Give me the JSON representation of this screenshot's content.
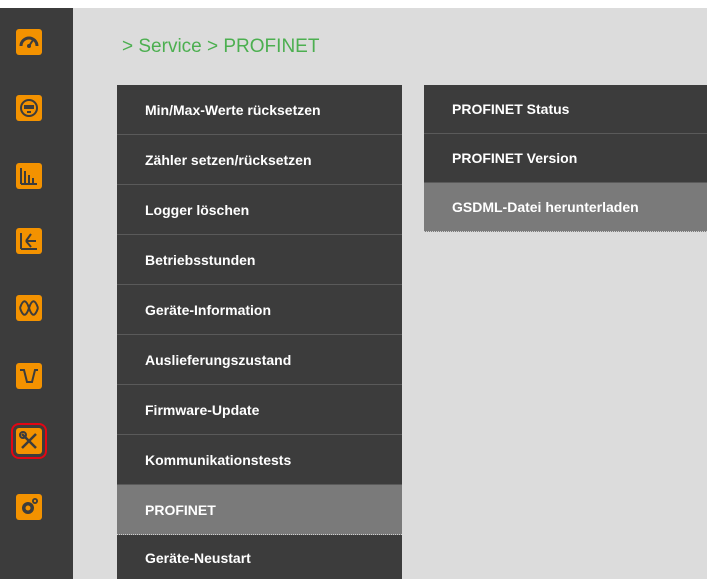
{
  "sidebar": {
    "accent_color": "#f39200",
    "active_outline_color": "#e30613",
    "items": [
      {
        "icon": "gauge-icon",
        "active": false
      },
      {
        "icon": "meter-display-icon",
        "active": false
      },
      {
        "icon": "bar-chart-icon",
        "active": false
      },
      {
        "icon": "phasor-diagram-icon",
        "active": false
      },
      {
        "icon": "harmonics-wave-icon",
        "active": false
      },
      {
        "icon": "dip-waveform-icon",
        "active": false
      },
      {
        "icon": "service-tools-icon",
        "active": true
      },
      {
        "icon": "settings-gears-icon",
        "active": false
      }
    ]
  },
  "breadcrumb": "> Service > PROFINET",
  "left_menu": [
    {
      "label": "Min/Max-Werte rücksetzen",
      "selected": false
    },
    {
      "label": "Zähler setzen/rücksetzen",
      "selected": false
    },
    {
      "label": "Logger löschen",
      "selected": false
    },
    {
      "label": "Betriebsstunden",
      "selected": false
    },
    {
      "label": "Geräte-Information",
      "selected": false
    },
    {
      "label": "Auslieferungszustand",
      "selected": false
    },
    {
      "label": "Firmware-Update",
      "selected": false
    },
    {
      "label": "Kommunikationstests",
      "selected": false
    },
    {
      "label": "PROFINET",
      "selected": true
    },
    {
      "label": "Geräte-Neustart",
      "selected": false
    }
  ],
  "right_menu": [
    {
      "label": "PROFINET Status",
      "selected": false
    },
    {
      "label": "PROFINET Version",
      "selected": false
    },
    {
      "label": "GSDML-Datei herunterladen",
      "selected": true
    }
  ]
}
